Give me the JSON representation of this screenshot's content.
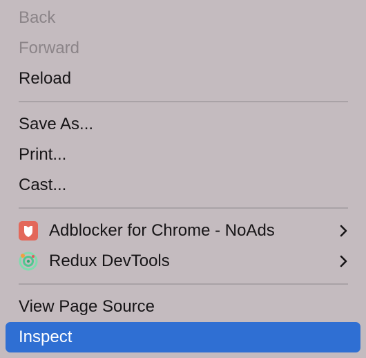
{
  "menu": {
    "back": "Back",
    "forward": "Forward",
    "reload": "Reload",
    "save_as": "Save As...",
    "print": "Print...",
    "cast": "Cast...",
    "adblocker": "Adblocker for Chrome - NoAds",
    "redux": "Redux DevTools",
    "view_source": "View Page Source",
    "inspect": "Inspect"
  },
  "icons": {
    "adblocker": "shield-icon",
    "redux": "redux-devtools-icon",
    "submenu": "chevron-right-icon"
  },
  "colors": {
    "menu_background": "#c4bbbf",
    "text": "#161416",
    "disabled_text": "#8b8488",
    "separator": "#a9a2a6",
    "selection": "#2f6fd3",
    "adblocker_icon": "#e3685a",
    "redux_icon": "#7fdcae"
  }
}
